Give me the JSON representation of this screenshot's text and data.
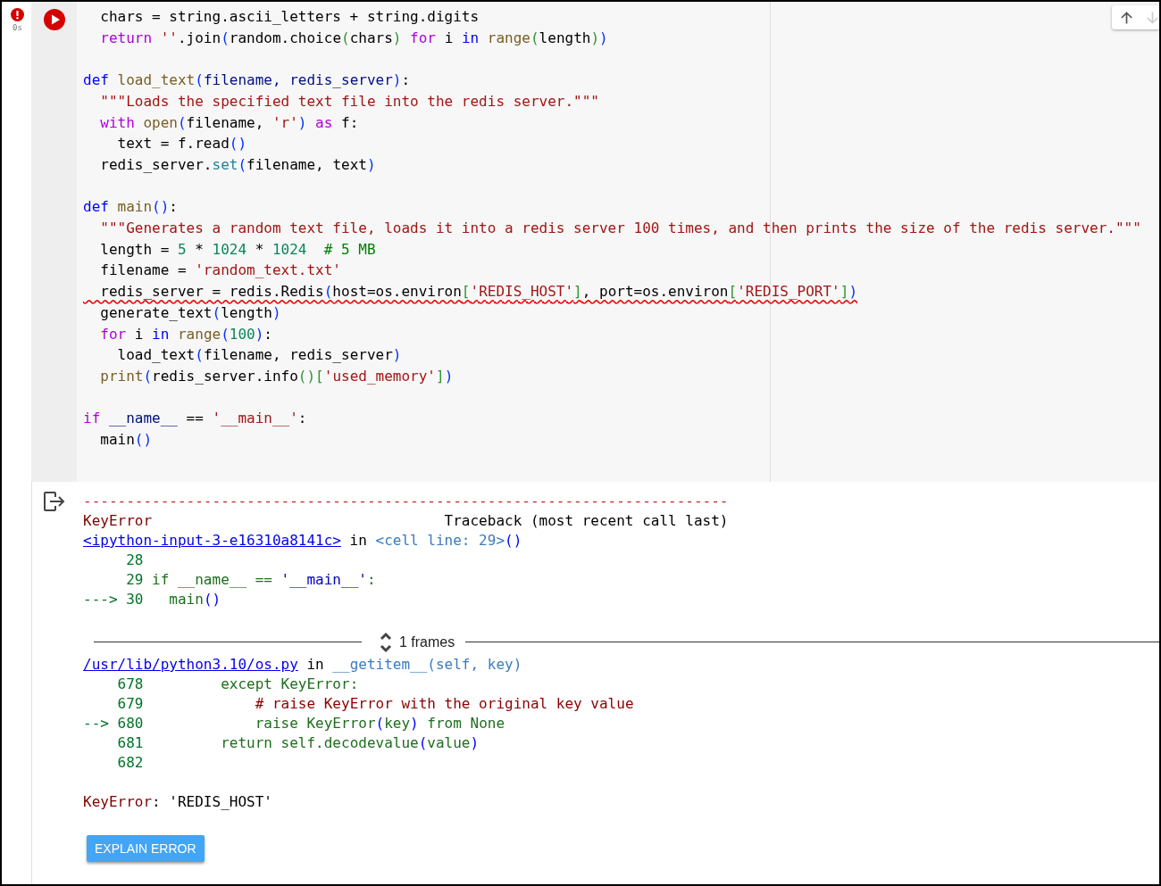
{
  "cell": {
    "status": {
      "error": true,
      "time": "0s"
    },
    "code_lines": [
      {
        "tokens": [
          {
            "kind": "plain",
            "text": "  chars = string.ascii_letters + string.digits"
          }
        ]
      },
      {
        "tokens": [
          {
            "kind": "ctrl",
            "text": "  return"
          },
          {
            "kind": "str",
            "text": " ''"
          },
          {
            "kind": "plain",
            "text": ".join"
          },
          {
            "kind": "br1",
            "text": "("
          },
          {
            "kind": "plain",
            "text": "random.choice"
          },
          {
            "kind": "br2",
            "text": "("
          },
          {
            "kind": "plain",
            "text": "chars"
          },
          {
            "kind": "br2",
            "text": ")"
          },
          {
            "kind": "ctrl",
            "text": " for"
          },
          {
            "kind": "plain",
            "text": " i "
          },
          {
            "kind": "kw",
            "text": "in"
          },
          {
            "kind": "fn",
            "text": " range"
          },
          {
            "kind": "br2",
            "text": "("
          },
          {
            "kind": "plain",
            "text": "length"
          },
          {
            "kind": "br2",
            "text": ")"
          },
          {
            "kind": "br1",
            "text": ")"
          }
        ]
      },
      {
        "gap_before": true,
        "tokens": [
          {
            "kind": "kw",
            "text": "def"
          },
          {
            "kind": "fn",
            "text": " load_text"
          },
          {
            "kind": "br1",
            "text": "("
          },
          {
            "kind": "param",
            "text": "filename"
          },
          {
            "kind": "param",
            "text": ", redis_server"
          },
          {
            "kind": "br1",
            "text": ")"
          },
          {
            "kind": "plain",
            "text": ":"
          }
        ]
      },
      {
        "tokens": [
          {
            "kind": "str",
            "text": "  \"\"\"Loads the specified text file into the redis server.\"\"\""
          }
        ]
      },
      {
        "tokens": [
          {
            "kind": "ctrl",
            "text": "  with"
          },
          {
            "kind": "fn",
            "text": " open"
          },
          {
            "kind": "br1",
            "text": "("
          },
          {
            "kind": "plain",
            "text": "filename, "
          },
          {
            "kind": "str",
            "text": "'r'"
          },
          {
            "kind": "br1",
            "text": ")"
          },
          {
            "kind": "ctrl",
            "text": " as"
          },
          {
            "kind": "plain",
            "text": " f:"
          }
        ]
      },
      {
        "tokens": [
          {
            "kind": "plain",
            "text": "    text = f.read"
          },
          {
            "kind": "br1",
            "text": "()"
          }
        ]
      },
      {
        "tokens": [
          {
            "kind": "plain",
            "text": "  redis_server."
          },
          {
            "kind": "method",
            "text": "set"
          },
          {
            "kind": "br1",
            "text": "("
          },
          {
            "kind": "plain",
            "text": "filename, text"
          },
          {
            "kind": "br1",
            "text": ")"
          }
        ]
      },
      {
        "gap_before": true,
        "tokens": [
          {
            "kind": "kw",
            "text": "def"
          },
          {
            "kind": "fn",
            "text": " main"
          },
          {
            "kind": "br1",
            "text": "()"
          },
          {
            "kind": "plain",
            "text": ":"
          }
        ]
      },
      {
        "tokens": [
          {
            "kind": "str",
            "text": "  \"\"\"Generates a random text file, loads it into a redis server 100 times, and then prints the size of the redis server.\"\"\""
          }
        ]
      },
      {
        "tokens": [
          {
            "kind": "plain",
            "text": "  length = "
          },
          {
            "kind": "num",
            "text": "5"
          },
          {
            "kind": "plain",
            "text": " * "
          },
          {
            "kind": "num",
            "text": "1024"
          },
          {
            "kind": "plain",
            "text": " * "
          },
          {
            "kind": "num",
            "text": "1024"
          },
          {
            "kind": "comment",
            "text": "  # 5 MB"
          }
        ]
      },
      {
        "tokens": [
          {
            "kind": "plain",
            "text": "  filename = "
          },
          {
            "kind": "str",
            "text": "'random_text.txt'"
          }
        ]
      },
      {
        "error_underline": true,
        "tokens": [
          {
            "kind": "plain",
            "text": "  redis_server = redis.Redis"
          },
          {
            "kind": "br1",
            "text": "("
          },
          {
            "kind": "plain",
            "text": "host=os.environ"
          },
          {
            "kind": "br2",
            "text": "["
          },
          {
            "kind": "str",
            "text": "'REDIS_HOST'"
          },
          {
            "kind": "br2",
            "text": "]"
          },
          {
            "kind": "plain",
            "text": ", port=os.environ"
          },
          {
            "kind": "br2",
            "text": "["
          },
          {
            "kind": "str",
            "text": "'REDIS_PORT'"
          },
          {
            "kind": "br2",
            "text": "]"
          },
          {
            "kind": "br1",
            "text": ")"
          }
        ]
      },
      {
        "tokens": [
          {
            "kind": "plain",
            "text": "  generate_text"
          },
          {
            "kind": "br1",
            "text": "("
          },
          {
            "kind": "plain",
            "text": "length"
          },
          {
            "kind": "br1",
            "text": ")"
          }
        ]
      },
      {
        "tokens": [
          {
            "kind": "ctrl",
            "text": "  for"
          },
          {
            "kind": "plain",
            "text": " i "
          },
          {
            "kind": "kw",
            "text": "in"
          },
          {
            "kind": "fn",
            "text": " range"
          },
          {
            "kind": "br1",
            "text": "("
          },
          {
            "kind": "num",
            "text": "100"
          },
          {
            "kind": "br1",
            "text": ")"
          },
          {
            "kind": "plain",
            "text": ":"
          }
        ]
      },
      {
        "tokens": [
          {
            "kind": "plain",
            "text": "    load_text"
          },
          {
            "kind": "br1",
            "text": "("
          },
          {
            "kind": "plain",
            "text": "filename, redis_server"
          },
          {
            "kind": "br1",
            "text": ")"
          }
        ]
      },
      {
        "tokens": [
          {
            "kind": "fn",
            "text": "  print"
          },
          {
            "kind": "br1",
            "text": "("
          },
          {
            "kind": "plain",
            "text": "redis_server.info"
          },
          {
            "kind": "br2",
            "text": "()"
          },
          {
            "kind": "br2",
            "text": "["
          },
          {
            "kind": "str",
            "text": "'used_memory'"
          },
          {
            "kind": "br2",
            "text": "]"
          },
          {
            "kind": "br1",
            "text": ")"
          }
        ]
      },
      {
        "gap_before": true,
        "tokens": [
          {
            "kind": "ctrl",
            "text": "if"
          },
          {
            "kind": "param",
            "text": " __name__"
          },
          {
            "kind": "plain",
            "text": " == "
          },
          {
            "kind": "str",
            "text": "'__main__'"
          },
          {
            "kind": "plain",
            "text": ":"
          }
        ]
      },
      {
        "tokens": [
          {
            "kind": "plain",
            "text": "  main"
          },
          {
            "kind": "br1",
            "text": "()"
          }
        ]
      }
    ]
  },
  "output": {
    "rows": [
      {
        "kind": "code",
        "tokens": [
          {
            "kind": "dash",
            "text": "---------------------------------------------------------------------------"
          }
        ]
      },
      {
        "kind": "code",
        "tokens": [
          {
            "kind": "err",
            "text": "KeyError"
          },
          {
            "kind": "plain",
            "text": "                                  Traceback (most recent call last)"
          }
        ]
      },
      {
        "kind": "code",
        "link": "<ipython-input-3-e16310a8141c>",
        "tokens": [
          {
            "kind": "plain",
            "text": " in "
          },
          {
            "kind": "cellref",
            "text": "<cell line: 29>"
          },
          {
            "kind": "tbr",
            "text": "()"
          }
        ]
      },
      {
        "kind": "code",
        "tokens": [
          {
            "kind": "lineno",
            "text": "     28"
          }
        ]
      },
      {
        "kind": "code",
        "tokens": [
          {
            "kind": "lineno",
            "text": "     29"
          },
          {
            "kind": "tcode",
            "text": " if __name__ == "
          },
          {
            "kind": "tstr",
            "text": "'__main__'"
          },
          {
            "kind": "tcode",
            "text": ":"
          }
        ]
      },
      {
        "kind": "code",
        "tokens": [
          {
            "kind": "lineno",
            "text": "---> 30"
          },
          {
            "kind": "tcode",
            "text": "   main"
          },
          {
            "kind": "tbr",
            "text": "()"
          }
        ]
      },
      {
        "kind": "frames",
        "label": "1 frames"
      },
      {
        "kind": "code",
        "link": "/usr/lib/python3.10/os.py",
        "tokens": [
          {
            "kind": "plain",
            "text": " in "
          },
          {
            "kind": "cellref",
            "text": "__getitem__(self, key)"
          }
        ]
      },
      {
        "kind": "code",
        "tokens": [
          {
            "kind": "lineno",
            "text": "    678"
          },
          {
            "kind": "tcode",
            "text": "         except KeyError:"
          }
        ]
      },
      {
        "kind": "code",
        "tokens": [
          {
            "kind": "lineno",
            "text": "    679"
          },
          {
            "kind": "tcomment",
            "text": "             # raise KeyError with the original key value"
          }
        ]
      },
      {
        "kind": "code",
        "tokens": [
          {
            "kind": "lineno",
            "text": "--> 680"
          },
          {
            "kind": "tcode",
            "text": "             raise KeyError"
          },
          {
            "kind": "tbr",
            "text": "("
          },
          {
            "kind": "tcode",
            "text": "key"
          },
          {
            "kind": "tbr",
            "text": ")"
          },
          {
            "kind": "tcode",
            "text": " from None"
          }
        ]
      },
      {
        "kind": "code",
        "tokens": [
          {
            "kind": "lineno",
            "text": "    681"
          },
          {
            "kind": "tcode",
            "text": "         return self.decodevalue"
          },
          {
            "kind": "tbr",
            "text": "("
          },
          {
            "kind": "tcode",
            "text": "value"
          },
          {
            "kind": "tbr",
            "text": ")"
          }
        ]
      },
      {
        "kind": "code",
        "tokens": [
          {
            "kind": "lineno",
            "text": "    682"
          }
        ]
      },
      {
        "kind": "code",
        "gap_before": true,
        "tokens": [
          {
            "kind": "err",
            "text": "KeyError"
          },
          {
            "kind": "plain",
            "text": ": 'REDIS_HOST'"
          }
        ]
      }
    ],
    "explain_button": "EXPLAIN ERROR"
  }
}
